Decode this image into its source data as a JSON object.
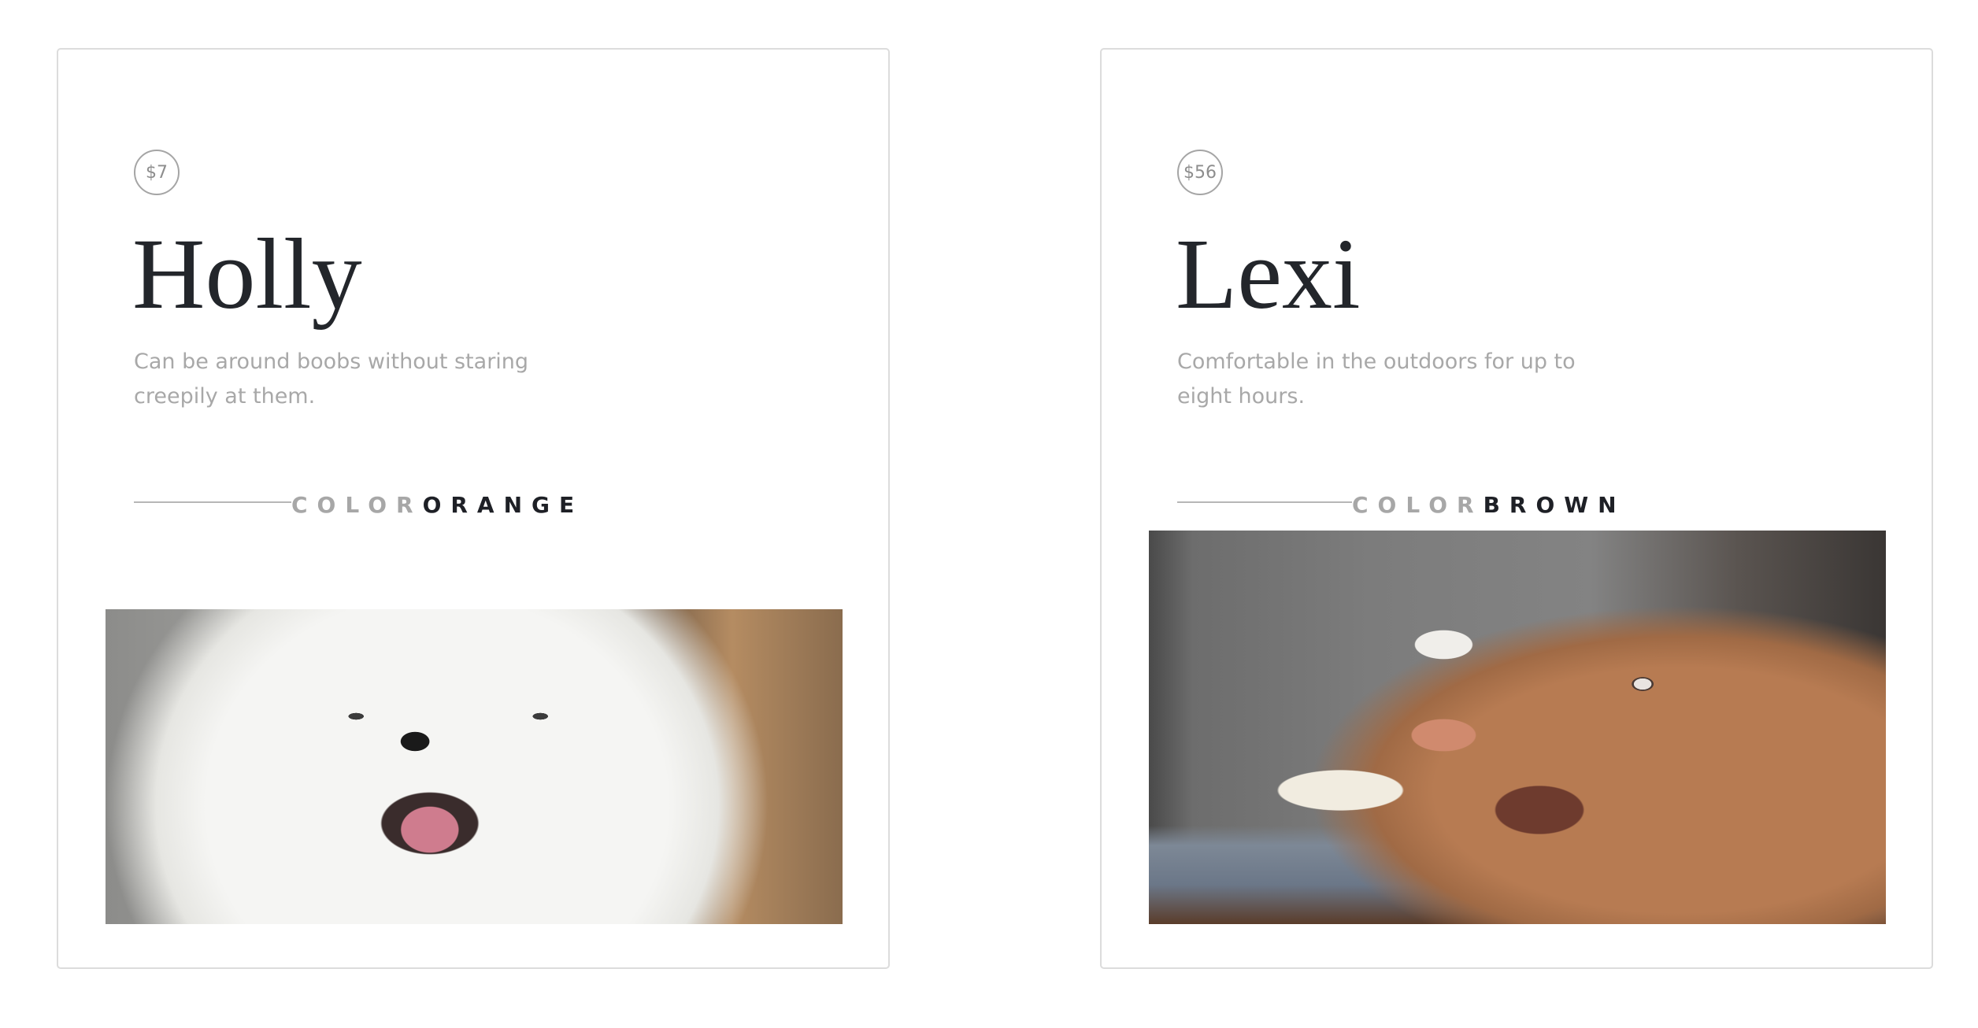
{
  "cards": [
    {
      "price": "$7",
      "name": "Holly",
      "description": "Can be around boobs without staring creepily at them.",
      "color_label": "COLOR",
      "color_value": "ORANGE",
      "photo": "white fluffy samoyed dog smiling"
    },
    {
      "price": "$56",
      "name": "Lexi",
      "description": "Comfortable in the outdoors for up to eight hours.",
      "color_label": "COLOR",
      "color_value": "BROWN",
      "photo": "brown dog with popsicle"
    }
  ]
}
